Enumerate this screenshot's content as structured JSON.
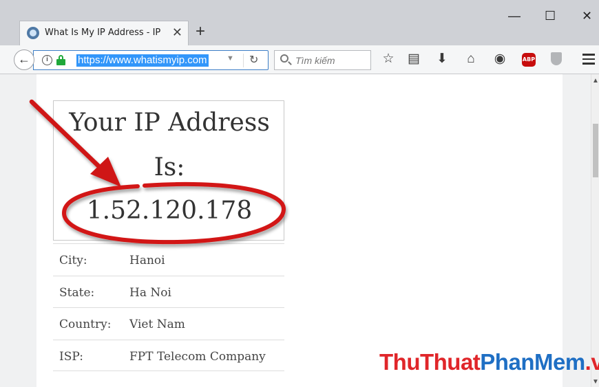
{
  "browser": {
    "tab_title": "What Is My IP Address - IP A",
    "tab_close": "✕",
    "new_tab": "+",
    "window_controls": {
      "minimize": "—",
      "maximize": "☐",
      "close": "✕"
    },
    "url": "https://www.whatismyip.com",
    "search_placeholder": "Tìm kiếm",
    "icons": [
      "back-arrow-icon",
      "info-icon",
      "lock-icon",
      "dropdown-icon",
      "reload-icon",
      "search-icon",
      "bookmark-star-icon",
      "reading-list-icon",
      "download-icon",
      "home-icon",
      "pocket-icon",
      "adblock-icon",
      "shield-icon",
      "hamburger-menu-icon"
    ],
    "abp_label": "ABP",
    "accent_color": "#3296fa"
  },
  "ip_card": {
    "heading_line1": "Your IP Address",
    "heading_line2": "Is:",
    "ip": "1.52.120.178"
  },
  "details": [
    {
      "label": "City:",
      "value": "Hanoi"
    },
    {
      "label": "State:",
      "value": "Ha Noi"
    },
    {
      "label": "Country:",
      "value": "Viet Nam"
    },
    {
      "label": "ISP:",
      "value": "FPT Telecom Company"
    }
  ],
  "watermark": {
    "part1": "ThuThuat",
    "part2": "PhanMem",
    "part3": ".vn"
  },
  "annotation_color": "#d01414"
}
